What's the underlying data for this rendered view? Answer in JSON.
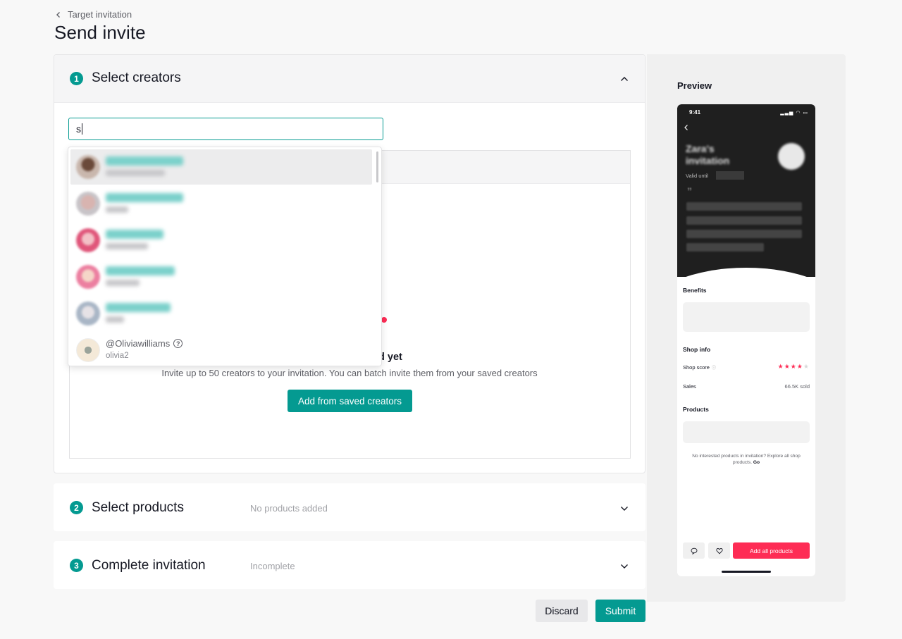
{
  "header": {
    "breadcrumb": "Target invitation",
    "title": "Send invite"
  },
  "steps": [
    {
      "number": "1",
      "title": "Select creators",
      "status": ""
    },
    {
      "number": "2",
      "title": "Select products",
      "status": "No products added"
    },
    {
      "number": "3",
      "title": "Complete invitation",
      "status": "Incomplete"
    }
  ],
  "search": {
    "value": "s",
    "placeholder": ""
  },
  "dropdown": {
    "items": [
      {
        "name": "@Oliviawilliams",
        "handle": "olivia2"
      }
    ]
  },
  "empty_state": {
    "title_visible_fragment": "d yet",
    "description": "Invite up to 50 creators to your invitation. You can batch invite them from your saved creators",
    "button": "Add from saved creators"
  },
  "actions": {
    "discard": "Discard",
    "submit": "Submit"
  },
  "preview": {
    "label": "Preview",
    "phone": {
      "time": "9:41",
      "title": "Zara's invitation",
      "valid_until": "Valid until",
      "quote_mark": "”",
      "benefits_title": "Benefits",
      "shop_info_title": "Shop info",
      "shop_score_label": "Shop score",
      "shop_score_stars": 4,
      "sales_label": "Sales",
      "sales_value": "66.5K sold",
      "products_title": "Products",
      "note": "No interested products in invitation? Explore all shop products.",
      "note_link": "Go",
      "add_all_button": "Add all products"
    }
  },
  "colors": {
    "accent": "#049a91",
    "brand_red": "#fe2c55"
  }
}
